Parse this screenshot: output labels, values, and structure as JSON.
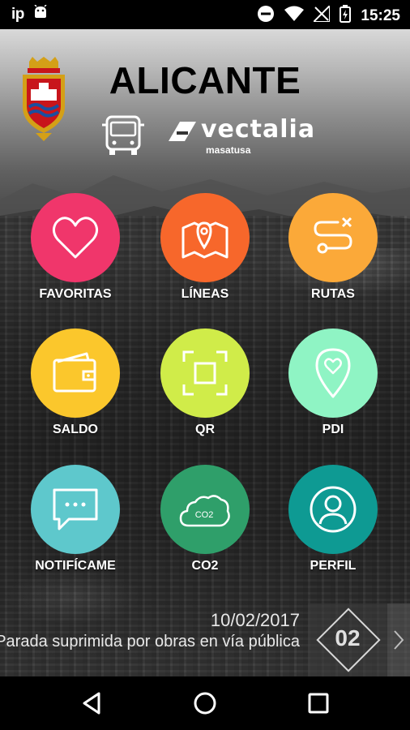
{
  "status_bar": {
    "app_indicator": "ip",
    "time": "15:25",
    "icons": [
      "android-icon",
      "do-not-disturb-icon",
      "wifi-icon",
      "no-signal-icon",
      "battery-charging-icon"
    ]
  },
  "header": {
    "city": "ALICANTE",
    "brand": "vectalia",
    "brand_sub": "masatusa"
  },
  "menu": [
    {
      "label": "FAVORITAS",
      "icon": "heart-icon",
      "color": "#f0366b"
    },
    {
      "label": "LÍNEAS",
      "icon": "map-icon",
      "color": "#f7672b"
    },
    {
      "label": "RUTAS",
      "icon": "route-icon",
      "color": "#fba939"
    },
    {
      "label": "SALDO",
      "icon": "wallet-icon",
      "color": "#fbc72c"
    },
    {
      "label": "QR",
      "icon": "scan-icon",
      "color": "#d0ec49"
    },
    {
      "label": "PDI",
      "icon": "location-heart-icon",
      "color": "#8ff4c4"
    },
    {
      "label": "NOTIFÍCAME",
      "icon": "chat-icon",
      "color": "#5ec8cc"
    },
    {
      "label": "CO2",
      "icon": "co2-cloud-icon",
      "color": "#2f9f6a"
    },
    {
      "label": "PERFIL",
      "icon": "user-icon",
      "color": "#0e9a93"
    }
  ],
  "news": {
    "date": "10/02/2017",
    "text": "Parada suprimida por obras en vía pública",
    "badge": "02"
  },
  "nav": {
    "icons": [
      "back-icon",
      "home-icon",
      "recents-icon"
    ]
  }
}
